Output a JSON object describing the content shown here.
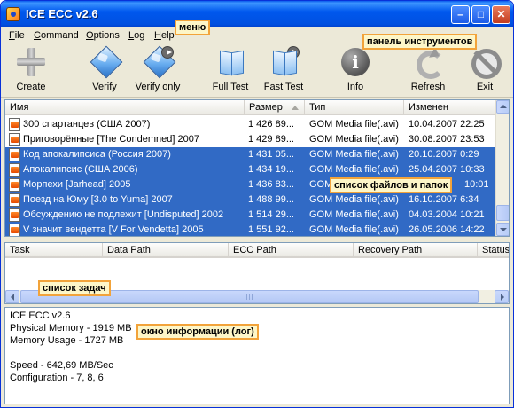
{
  "window": {
    "title": "ICE ECC v2.6"
  },
  "menu": [
    {
      "prefix": "",
      "underline": "F",
      "rest": "ile"
    },
    {
      "prefix": "",
      "underline": "C",
      "rest": "ommand"
    },
    {
      "prefix": "",
      "underline": "O",
      "rest": "ptions"
    },
    {
      "prefix": "",
      "underline": "L",
      "rest": "og"
    },
    {
      "prefix": "",
      "underline": "H",
      "rest": "elp"
    }
  ],
  "annotations": {
    "menu": "меню",
    "toolbar": "панель инструментов",
    "files": "список файлов и папок",
    "tasks": "список задач",
    "log": "окно информации (лог)"
  },
  "toolbar": {
    "create": "Create",
    "verify": "Verify",
    "verify_only": "Verify only",
    "full_test": "Full Test",
    "fast_test": "Fast Test",
    "info": "Info",
    "refresh": "Refresh",
    "exit": "Exit"
  },
  "files": {
    "columns": {
      "name": "Имя",
      "size": "Размер",
      "type": "Тип",
      "modified": "Изменен"
    },
    "rows": [
      {
        "name": "300 спартанцев (США 2007)",
        "size": "1 426 89...",
        "type": "GOM Media file(.avi)",
        "modified": "10.04.2007 22:25"
      },
      {
        "name": "Приговорённые [The Condemned] 2007",
        "size": "1 429 89...",
        "type": "GOM Media file(.avi)",
        "modified": "30.08.2007 23:53"
      },
      {
        "name": "Код апокалипсиса (Россия 2007)",
        "size": "1 431 05...",
        "type": "GOM Media file(.avi)",
        "modified": "20.10.2007 0:29"
      },
      {
        "name": "Апокалипсис (США 2006)",
        "size": "1 434 19...",
        "type": "GOM Media file(.avi)",
        "modified": "25.04.2007 10:33"
      },
      {
        "name": "Морпехи [Jarhead] 2005",
        "size": "1 436 83...",
        "type": "GOM",
        "modified": "10:01"
      },
      {
        "name": "Поезд на Юму [3.0 to Yuma] 2007",
        "size": "1 488 99...",
        "type": "GOM Media file(.avi)",
        "modified": "16.10.2007 6:34"
      },
      {
        "name": "Обсуждению не подлежит [Undisputed] 2002",
        "size": "1 514 29...",
        "type": "GOM Media file(.avi)",
        "modified": "04.03.2004 10:21"
      },
      {
        "name": "V значит вендетта [V For Vendetta] 2005",
        "size": "1 551 92...",
        "type": "GOM Media file(.avi)",
        "modified": "26.05.2006 14:22"
      }
    ]
  },
  "tasks": {
    "columns": {
      "task": "Task",
      "data_path": "Data Path",
      "ecc_path": "ECC Path",
      "recovery_path": "Recovery Path",
      "status": "Status"
    }
  },
  "log": {
    "lines": [
      "ICE ECC v2.6",
      "Physical Memory - 1919 MB",
      "Memory Usage - 1727 MB",
      "",
      "Speed - 642,69 MB/Sec",
      "Configuration - 7, 8, 6"
    ]
  },
  "colors": {
    "selection": "#316AC5",
    "titlebar": "#0058EE",
    "annotation_border": "#F2A33A"
  }
}
